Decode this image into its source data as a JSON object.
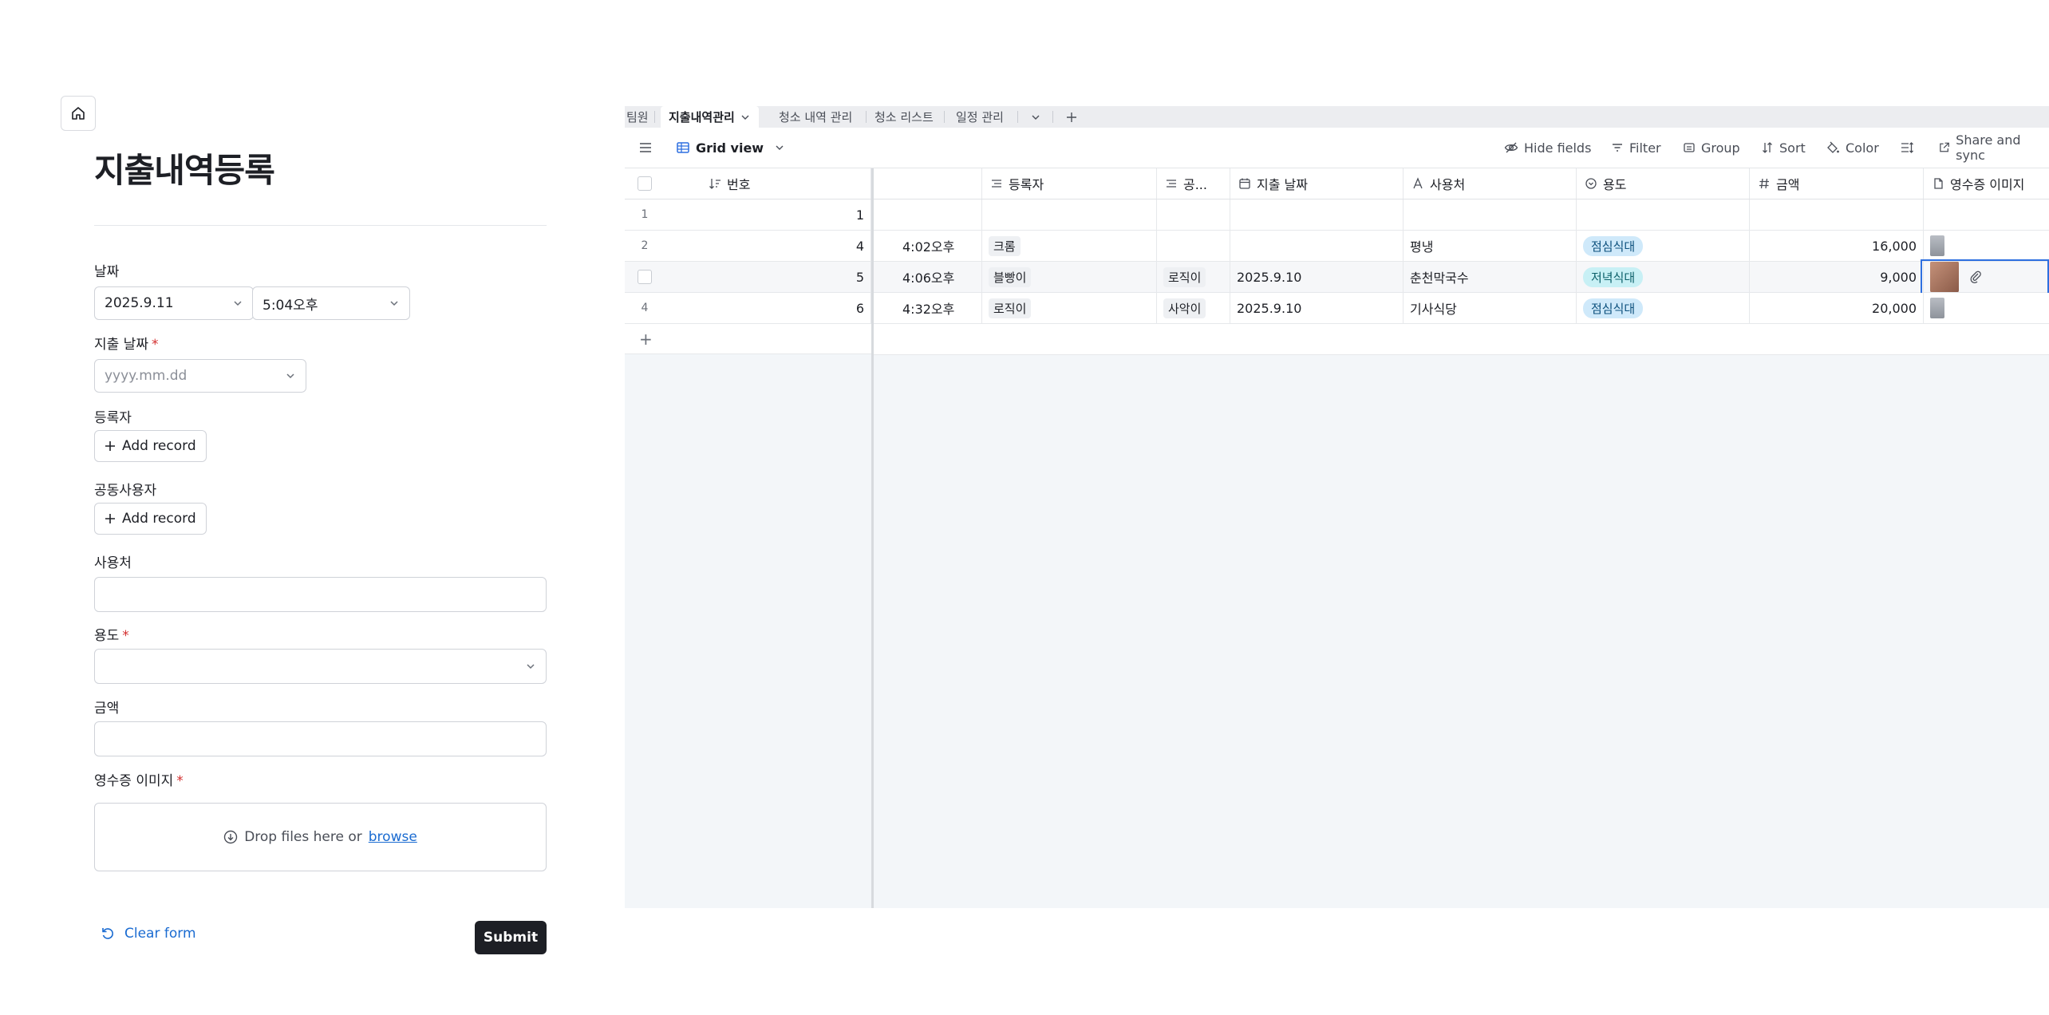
{
  "form": {
    "title": "지출내역등록",
    "date_label": "날짜",
    "date_value": "2025.9.11",
    "time_value": "5:04오후",
    "expense_date_label": "지출 날짜",
    "expense_date_placeholder": "yyyy.mm.dd",
    "registrant_label": "등록자",
    "add_record": "Add record",
    "co_user_label": "공동사용자",
    "place_label": "사용처",
    "purpose_label": "용도",
    "amount_label": "금액",
    "receipt_label": "영수증 이미지",
    "required_mark": "*",
    "drop_text": "Drop files here or",
    "browse": "browse",
    "clear_form": "Clear form",
    "submit": "Submit"
  },
  "tabs": [
    "팀원",
    "지출내역관리",
    "청소 내역 관리",
    "청소 리스트",
    "일정 관리"
  ],
  "toolbar": {
    "view": "Grid view",
    "hide_fields": "Hide fields",
    "filter": "Filter",
    "group": "Group",
    "sort": "Sort",
    "color": "Color",
    "share": "Share and sync"
  },
  "columns": {
    "number": "번호",
    "registrant": "등록자",
    "co_user": "공...",
    "expense_date": "지출 날짜",
    "place": "사용처",
    "purpose": "용도",
    "amount": "금액",
    "receipt": "영수증 이미지"
  },
  "rows": [
    {
      "rownum": "1",
      "number": "1",
      "time": "",
      "registrant": "",
      "co_user": "",
      "date": "",
      "place": "",
      "purpose": "",
      "amount": ""
    },
    {
      "rownum": "2",
      "number": "4",
      "time": "4:02오후",
      "registrant": "크롬",
      "co_user": "",
      "date": "",
      "place": "평냉",
      "purpose": "점심식대",
      "amount": "16,000"
    },
    {
      "rownum": "",
      "number": "5",
      "time": "4:06오후",
      "registrant": "블빵이",
      "co_user": "로직이",
      "date": "2025.9.10",
      "place": "춘천막국수",
      "purpose": "저녁식대",
      "amount": "9,000"
    },
    {
      "rownum": "4",
      "number": "6",
      "time": "4:32오후",
      "registrant": "로직이",
      "co_user": "사악이",
      "date": "2025.9.10",
      "place": "기사식당",
      "purpose": "점심식대",
      "amount": "20,000"
    }
  ],
  "colors": {
    "accent": "#2d6fe0",
    "lunch_pill": "#cfe9fa",
    "dinner_pill": "#c8f0f5",
    "submit_bg": "#1d1f25"
  }
}
